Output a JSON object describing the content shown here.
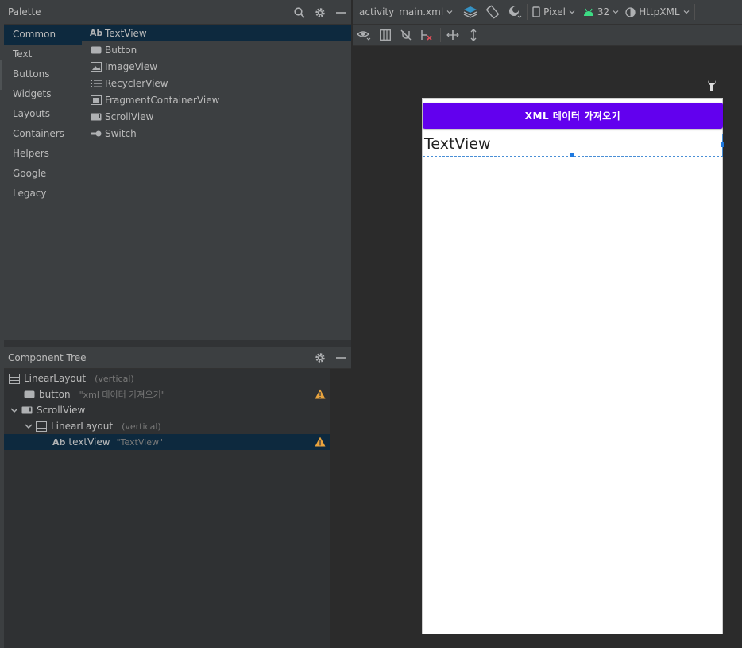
{
  "palette": {
    "title": "Palette",
    "categories": [
      "Common",
      "Text",
      "Buttons",
      "Widgets",
      "Layouts",
      "Containers",
      "Helpers",
      "Google",
      "Legacy"
    ],
    "selected_category": "Common",
    "widgets": [
      {
        "icon": "ab-text-icon",
        "icon_text": "Ab",
        "label": "TextView",
        "selected": true
      },
      {
        "icon": "button-icon",
        "label": "Button"
      },
      {
        "icon": "image-icon",
        "label": "ImageView"
      },
      {
        "icon": "list-icon",
        "label": "RecyclerView"
      },
      {
        "icon": "fragment-icon",
        "label": "FragmentContainerView"
      },
      {
        "icon": "scrollview-icon",
        "label": "ScrollView"
      },
      {
        "icon": "switch-icon",
        "label": "Switch"
      }
    ]
  },
  "component_tree": {
    "title": "Component Tree",
    "nodes": [
      {
        "label": "LinearLayout",
        "hint": "(vertical)",
        "depth": 0,
        "icon": "linear-layout-icon"
      },
      {
        "label": "button",
        "hint": "\"xml 데이터 가져오기\"",
        "depth": 1,
        "icon": "button-icon",
        "warning": true
      },
      {
        "label": "ScrollView",
        "hint": "",
        "depth": 0,
        "icon": "scrollview-icon",
        "expanded": true
      },
      {
        "label": "LinearLayout",
        "hint": "(vertical)",
        "depth": 1,
        "icon": "linear-layout-icon",
        "expanded": true
      },
      {
        "label": "textView",
        "hint": "\"TextView\"",
        "depth": 2,
        "icon": "ab-text-icon",
        "icon_text": "Ab",
        "warning": true,
        "selected": true
      }
    ]
  },
  "toolbar": {
    "file": "activity_main.xml",
    "device": "Pixel",
    "api": "32",
    "theme": "HttpXML"
  },
  "preview": {
    "button_label": "XML 데이터 가져오기",
    "text": "TextView"
  },
  "colors": {
    "button_purple": "#6200ee",
    "selection": "#0d293e",
    "warning": "#e8a33d",
    "android_green": "#3ddc84"
  }
}
